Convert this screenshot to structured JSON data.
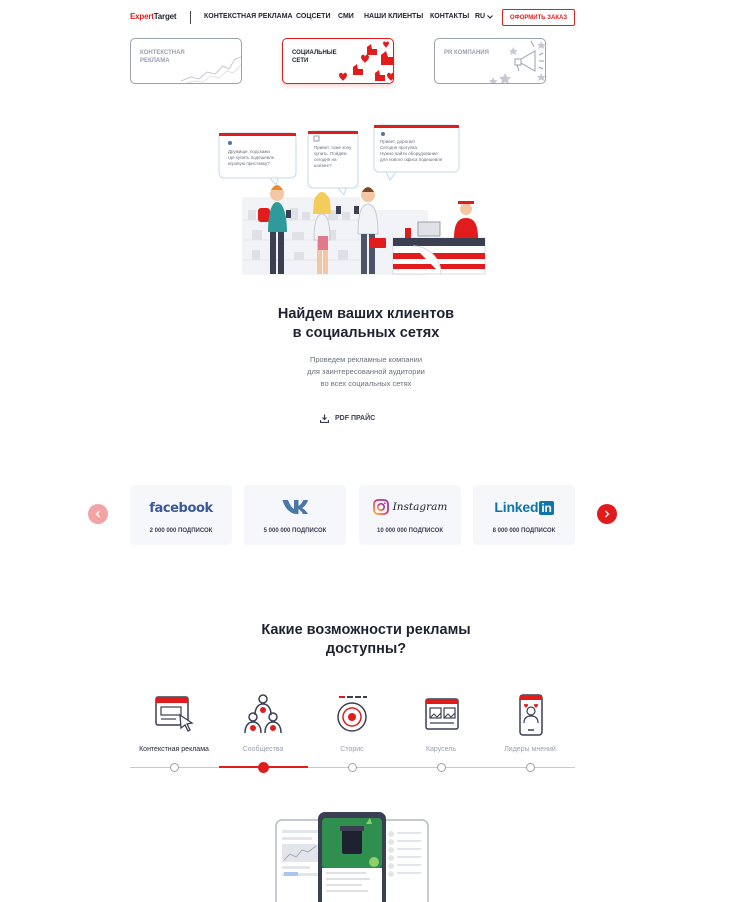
{
  "header": {
    "logo_part1": "Expert",
    "logo_part2": "Target",
    "nav": [
      "КОНТЕКСТНАЯ РЕКЛАМА",
      "СОЦСЕТИ",
      "СМИ",
      "НАШИ КЛИЕНТЫ",
      "КОНТАКТЫ"
    ],
    "lang": "RU",
    "order_button": "ОФОРМИТЬ ЗАКАЗ"
  },
  "cards": [
    {
      "label": "КОНТЕКСТНАЯ РЕКЛАМА",
      "active": false
    },
    {
      "label": "СОЦИАЛЬНЫЕ СЕТИ",
      "active": true
    },
    {
      "label": "PR КОМПАНИЯ",
      "active": false
    }
  ],
  "hero": {
    "bubbles": [
      "Дружище, подскажи где купить подешевле игровую приставку?",
      "Привет, тоже хочу купить. Пойдём сегодня на шопинг?",
      "Привет, дорогая! Сегодня прогулка. Нужно найти оборудование для нового офиса подешевле"
    ],
    "title_line1": "Найдем ваших клиентов",
    "title_line2": "в социальных сетях",
    "subtitle_line1": "Проведем рекламные компании",
    "subtitle_line2": "для заинтересованной аудитории",
    "subtitle_line3": "во всех социальных сетях",
    "pdf_label": "PDF ПРАЙС"
  },
  "social": {
    "prev_icon": "chevron-left-icon",
    "next_icon": "chevron-right-icon",
    "items": [
      {
        "name": "facebook",
        "subscribers": "2 000 000 ПОДПИСОК"
      },
      {
        "name": "VK",
        "subscribers": "5 000 000 ПОДПИСОК"
      },
      {
        "name": "Instagram",
        "subscribers": "10 000 000 ПОДПИСОК"
      },
      {
        "name": "LinkedIn",
        "subscribers": "8 000 000 ПОДПИСОК"
      }
    ]
  },
  "features": {
    "title_line1": "Какие возможности рекламы",
    "title_line2": "доступны?",
    "items": [
      {
        "label": "Контекстная реклама",
        "icon": "browser-cursor-icon"
      },
      {
        "label": "Сообщества",
        "icon": "community-icon"
      },
      {
        "label": "Сторис",
        "icon": "stories-icon"
      },
      {
        "label": "Карусель",
        "icon": "carousel-icon"
      },
      {
        "label": "Лидеры мнений",
        "icon": "influencer-icon"
      }
    ],
    "active_index": 1
  },
  "colors": {
    "accent": "#e21c1c",
    "text": "#1e2230",
    "muted": "#9aa0ae",
    "facebook": "#3b5998",
    "vk": "#4a76a8",
    "linkedin": "#0e76a8"
  }
}
